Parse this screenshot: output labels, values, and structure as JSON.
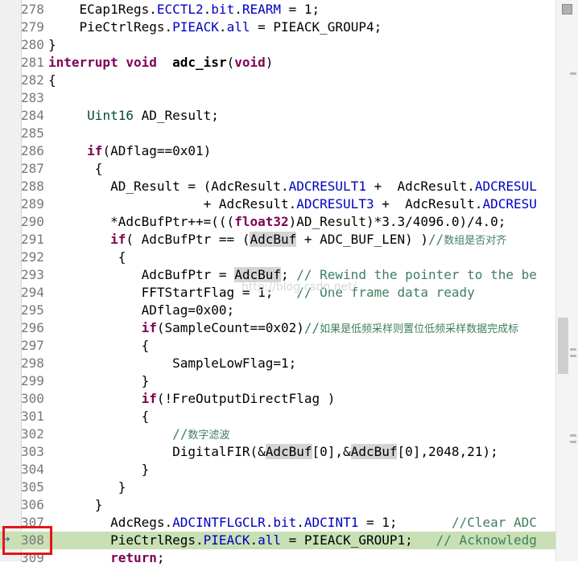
{
  "editor": {
    "lines": [
      {
        "n": "278",
        "html": "    ECap1Regs.<span class='fld'>ECCTL2</span>.<span class='fld'>bit</span>.<span class='fld'>REARM</span> = 1;"
      },
      {
        "n": "279",
        "html": "    PieCtrlRegs.<span class='fld'>PIEACK</span>.<span class='fld'>all</span> = PIEACK_GROUP4;"
      },
      {
        "n": "280",
        "html": "}"
      },
      {
        "n": "281",
        "html": "<span class='kw'>interrupt</span> <span class='kw'>void</span>  <span class='fn'>adc_isr</span>(<span class='kw'>void</span>)"
      },
      {
        "n": "282",
        "html": "{"
      },
      {
        "n": "283",
        "html": ""
      },
      {
        "n": "284",
        "html": "     <span class='ty'>Uint16</span> AD_Result;"
      },
      {
        "n": "285",
        "html": ""
      },
      {
        "n": "286",
        "html": "     <span class='kw'>if</span>(ADflag==0x01)"
      },
      {
        "n": "287",
        "html": "      {"
      },
      {
        "n": "288",
        "html": "        AD_Result = (AdcResult.<span class='fld'>ADCRESULT1</span> +  AdcResult.<span class='fld'>ADCRESUL</span>"
      },
      {
        "n": "289",
        "html": "                    + AdcResult.<span class='fld'>ADCRESULT3</span> +  AdcResult.<span class='fld'>ADCRESU</span>"
      },
      {
        "n": "290",
        "html": "        *AdcBufPtr++=(((<span class='kw'>float32</span>)AD_Result)*3.3/4096.0)/4.0;"
      },
      {
        "n": "291",
        "html": "        <span class='kw'>if</span>( AdcBufPtr == (<span class='mark'>AdcBuf</span> + ADC_BUF_LEN) )<span class='cm'>//</span><span class='cmcn'>数组是否对齐</span>"
      },
      {
        "n": "292",
        "html": "         {"
      },
      {
        "n": "293",
        "html": "            AdcBufPtr = <span class='mark'>AdcBuf</span>; <span class='cm'>// Rewind the pointer to the be</span>"
      },
      {
        "n": "294",
        "html": "            FFTStartFlag = 1;   <span class='cm'>// One frame data ready</span>"
      },
      {
        "n": "295",
        "html": "            ADflag=0x00;"
      },
      {
        "n": "296",
        "html": "            <span class='kw'>if</span>(SampleCount==0x02)<span class='cm'>//</span><span class='cmcn'>如果是低频采样则置位低频采样数据完成标</span>"
      },
      {
        "n": "297",
        "html": "            {"
      },
      {
        "n": "298",
        "html": "                SampleLowFlag=1;"
      },
      {
        "n": "299",
        "html": "            }"
      },
      {
        "n": "300",
        "html": "            <span class='kw'>if</span>(!FreOutputDirectFlag )"
      },
      {
        "n": "301",
        "html": "            {"
      },
      {
        "n": "302",
        "html": "                <span class='cm'>//</span><span class='cmcn'>数字滤波</span>"
      },
      {
        "n": "303",
        "html": "                DigitalFIR(&amp;<span class='mark'>AdcBuf</span>[0],&amp;<span class='mark'>AdcBuf</span>[0],2048,21);"
      },
      {
        "n": "304",
        "html": "            }"
      },
      {
        "n": "305",
        "html": "         }"
      },
      {
        "n": "306",
        "html": "      }"
      },
      {
        "n": "307",
        "html": "        AdcRegs.<span class='fld'>ADCINTFLGCLR</span>.<span class='fld'>bit</span>.<span class='fld'>ADCINT1</span> = 1;       <span class='cm'>//Clear ADC</span>"
      },
      {
        "n": "308",
        "html": "        PieCtrlRegs.<span class='fld'>PIEACK</span>.<span class='fld'>all</span> = PIEACK_GROUP1;   <span class='cm'>// Acknowledg</span>",
        "highlight": true
      },
      {
        "n": "309",
        "html": "        <span class='kw'>return</span>;"
      }
    ],
    "watermark": "http://blog.csdn.net/"
  }
}
